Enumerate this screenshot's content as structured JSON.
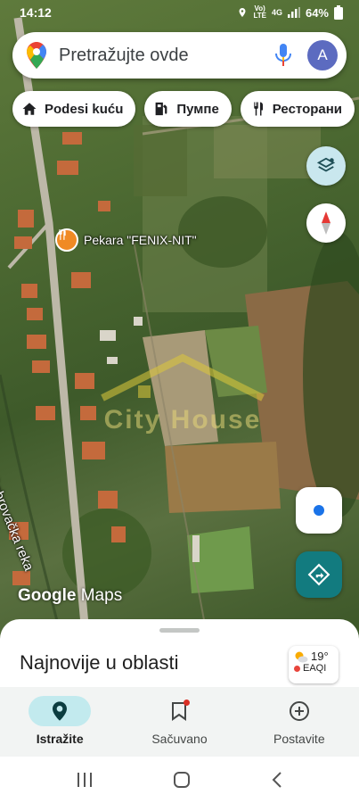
{
  "status_bar": {
    "time": "14:12",
    "network_top": "Vo)",
    "network_bottom": "LTE",
    "network_gen": "4G",
    "battery": "64%"
  },
  "search": {
    "placeholder": "Pretražujte ovde",
    "avatar_letter": "A"
  },
  "chips": [
    {
      "label": "Podesi kuću",
      "icon": "home-icon"
    },
    {
      "label": "Пумпе",
      "icon": "gas-pump-icon"
    },
    {
      "label": "Ресторани",
      "icon": "restaurant-icon"
    }
  ],
  "map": {
    "poi_label": "Pekara \"FENIX-NIT\"",
    "river_label": "Gabrovačka reka",
    "watermark": "City House",
    "logo_google": "Google",
    "logo_maps": "Maps"
  },
  "sheet": {
    "title": "Najnovije u oblasti",
    "weather_temp": "19°",
    "weather_aqi": "EAQI"
  },
  "bottom_nav": [
    {
      "label": "Istražite",
      "icon": "location-pin-icon",
      "active": true
    },
    {
      "label": "Sačuvano",
      "icon": "bookmark-icon",
      "active": false
    },
    {
      "label": "Postavite",
      "icon": "add-circle-icon",
      "active": false
    }
  ],
  "colors": {
    "accent_teal": "#127b7f",
    "active_tab": "#c2eaee",
    "poi_orange": "#f08a24"
  }
}
